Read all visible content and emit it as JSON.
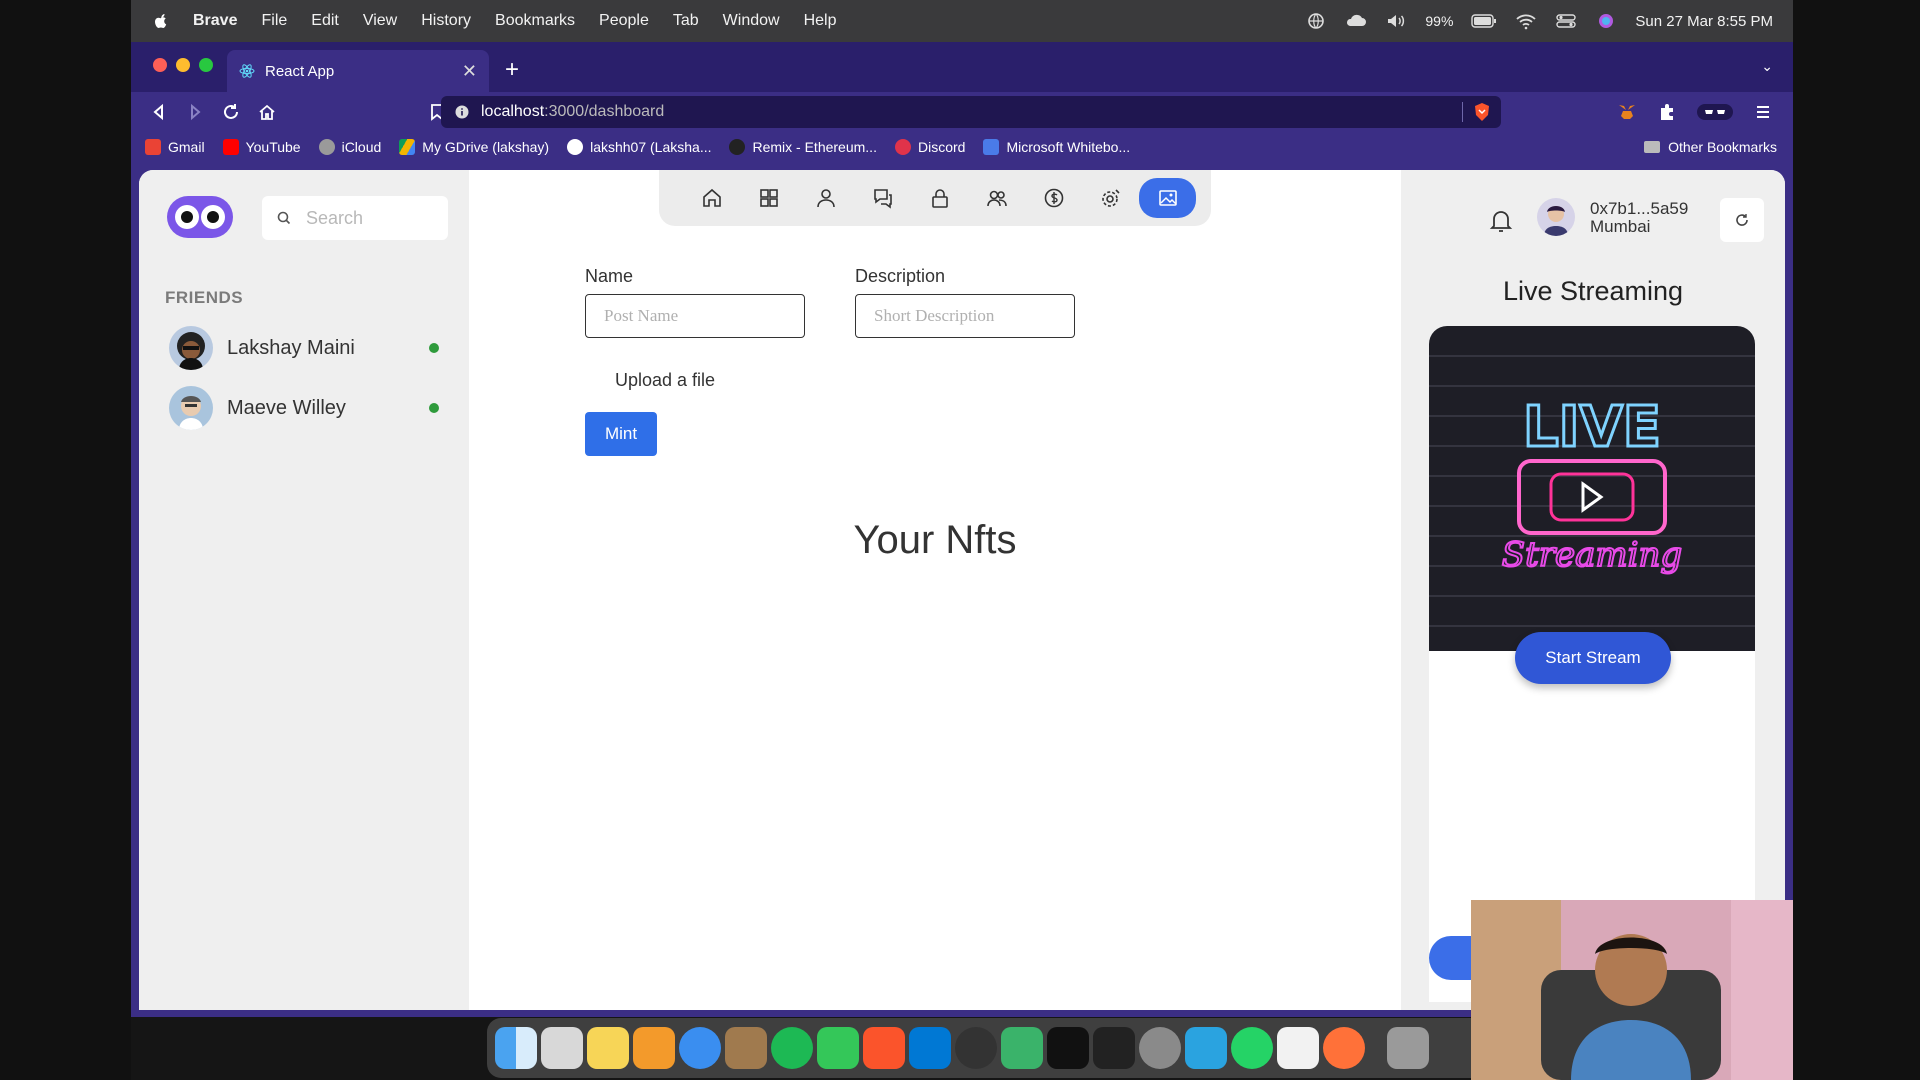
{
  "menubar": {
    "app": "Brave",
    "items": [
      "File",
      "Edit",
      "View",
      "History",
      "Bookmarks",
      "People",
      "Tab",
      "Window",
      "Help"
    ],
    "battery": "99%",
    "datetime": "Sun 27 Mar  8:55 PM"
  },
  "browser": {
    "tab_title": "React App",
    "url_host": "localhost",
    "url_path": ":3000/dashboard",
    "bookmarks": [
      {
        "label": "Gmail",
        "color": "#ea4335"
      },
      {
        "label": "YouTube",
        "color": "#ff0000"
      },
      {
        "label": "iCloud",
        "color": "#9a9a9a"
      },
      {
        "label": "My GDrive (lakshay)",
        "color": "#f4b400"
      },
      {
        "label": "lakshh07 (Laksha...",
        "color": "#ffffff"
      },
      {
        "label": "Remix - Ethereum...",
        "color": "#222222"
      },
      {
        "label": "Discord",
        "color": "#e0334a"
      },
      {
        "label": "Microsoft Whitebo...",
        "color": "#4a7be8"
      }
    ],
    "other_bookmarks": "Other Bookmarks"
  },
  "sidebar": {
    "search_placeholder": "Search",
    "friends_title": "FRIENDS",
    "friends": [
      {
        "name": "Lakshay Maini",
        "online": true
      },
      {
        "name": "Maeve Willey",
        "online": true
      }
    ]
  },
  "main": {
    "name_label": "Name",
    "name_placeholder": "Post Name",
    "description_label": "Description",
    "description_placeholder": "Short Description",
    "upload_label": "Upload a file",
    "mint_label": "Mint",
    "nfts_title": "Your Nfts",
    "nav_icons": [
      "home-icon",
      "dashboard-icon",
      "profile-icon",
      "chat-icon",
      "lock-icon",
      "friends-icon",
      "dollar-icon",
      "settings-icon",
      "gallery-icon"
    ],
    "active_nav": "gallery-icon"
  },
  "right": {
    "address": "0x7b1...5a59",
    "location": "Mumbai",
    "live_title": "Live Streaming",
    "start_stream_label": "Start Stream",
    "accent": "#3057d6"
  }
}
